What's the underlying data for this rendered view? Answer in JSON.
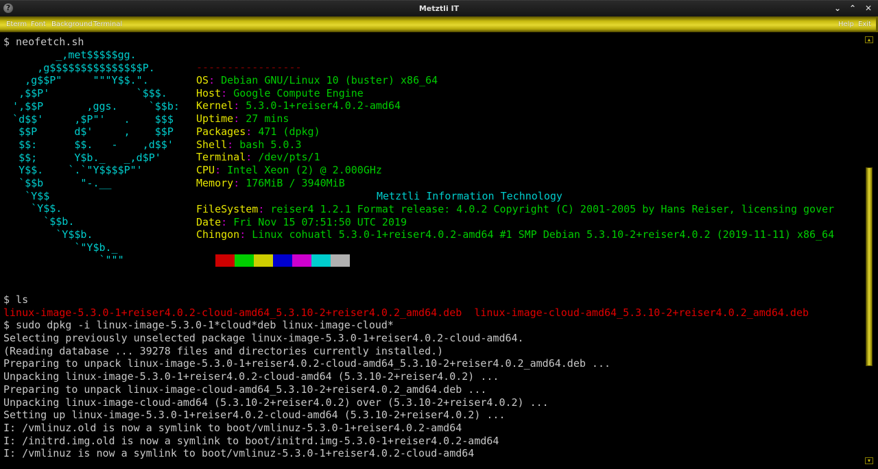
{
  "window": {
    "title": "Metztli IT",
    "help_icon": "?",
    "controls": {
      "minimize": "⌄",
      "maximize": "⌃",
      "close": "✕"
    }
  },
  "menubar": {
    "left": [
      "Eterm",
      "Font",
      "Background",
      "Terminal"
    ],
    "right": [
      "Help",
      "Exit"
    ]
  },
  "terminal": {
    "command1": "$ neofetch.sh",
    "ascii_art": [
      "         _,met$$$$$gg.",
      "      ,g$$$$$$$$$$$$$$$P.",
      "    ,g$$P\"     \"\"\"Y$$.\".",
      "   ,$$P'              `$$$.",
      "  ',$$P       ,ggs.     `$$b:",
      "  `d$$'     ,$P\"'   .    $$$",
      "   $$P      d$'     ,    $$P",
      "   $$:      $$.   -    ,d$$'",
      "   $$;      Y$b._   _,d$P'",
      "   Y$$.    `.`\"Y$$$$P\"'",
      "   `$$b      \"-.__",
      "    `Y$$",
      "     `Y$$.",
      "       `$$b.",
      "         `Y$$b.",
      "            `\"Y$b._",
      "                `\"\"\""
    ],
    "separator": "-----------------",
    "info": [
      {
        "key": "OS",
        "value": "Debian GNU/Linux 10 (buster) x86_64"
      },
      {
        "key": "Host",
        "value": "Google Compute Engine"
      },
      {
        "key": "Kernel",
        "value": "5.3.0-1+reiser4.0.2-amd64"
      },
      {
        "key": "Uptime",
        "value": "27 mins"
      },
      {
        "key": "Packages",
        "value": "471 (dpkg)"
      },
      {
        "key": "Shell",
        "value": "bash 5.0.3"
      },
      {
        "key": "Terminal",
        "value": "/dev/pts/1"
      },
      {
        "key": "CPU",
        "value": "Intel Xeon (2) @ 2.000GHz"
      },
      {
        "key": "Memory",
        "value": "176MiB / 3940MiB"
      }
    ],
    "banner": "Metztli Information Technology",
    "info2": [
      {
        "key": "FileSystem",
        "value": "reiser4 1.2.1 Format release: 4.0.2 Copyright (C) 2001-2005 by Hans Reiser, licensing gover"
      },
      {
        "key": "Date",
        "value": "Fri Nov 15 07:51:50 UTC 2019"
      },
      {
        "key": "Chingon",
        "value": "Linux cohuatl 5.3.0-1+reiser4.0.2-amd64 #1 SMP Debian 5.3.10-2+reiser4.0.2 (2019-11-11) x86_64"
      }
    ],
    "palette": [
      "#cd0000",
      "#00cd00",
      "#cdcd00",
      "#0000cd",
      "#cd00cd",
      "#00cdcd",
      "#b0b0b0"
    ],
    "command2": "$ ls",
    "ls_output": "linux-image-5.3.0-1+reiser4.0.2-cloud-amd64_5.3.10-2+reiser4.0.2_amd64.deb  linux-image-cloud-amd64_5.3.10-2+reiser4.0.2_amd64.deb",
    "command3": "$ sudo dpkg -i linux-image-5.3.0-1*cloud*deb linux-image-cloud*",
    "output": [
      "Selecting previously unselected package linux-image-5.3.0-1+reiser4.0.2-cloud-amd64.",
      "(Reading database ... 39278 files and directories currently installed.)",
      "Preparing to unpack linux-image-5.3.0-1+reiser4.0.2-cloud-amd64_5.3.10-2+reiser4.0.2_amd64.deb ...",
      "Unpacking linux-image-5.3.0-1+reiser4.0.2-cloud-amd64 (5.3.10-2+reiser4.0.2) ...",
      "Preparing to unpack linux-image-cloud-amd64_5.3.10-2+reiser4.0.2_amd64.deb ...",
      "Unpacking linux-image-cloud-amd64 (5.3.10-2+reiser4.0.2) over (5.3.10-2+reiser4.0.2) ...",
      "Setting up linux-image-5.3.0-1+reiser4.0.2-cloud-amd64 (5.3.10-2+reiser4.0.2) ...",
      "I: /vmlinuz.old is now a symlink to boot/vmlinuz-5.3.0-1+reiser4.0.2-amd64",
      "I: /initrd.img.old is now a symlink to boot/initrd.img-5.3.0-1+reiser4.0.2-amd64",
      "I: /vmlinuz is now a symlink to boot/vmlinuz-5.3.0-1+reiser4.0.2-cloud-amd64"
    ]
  },
  "scrollbar": {
    "up": "▲",
    "down": "▼"
  }
}
